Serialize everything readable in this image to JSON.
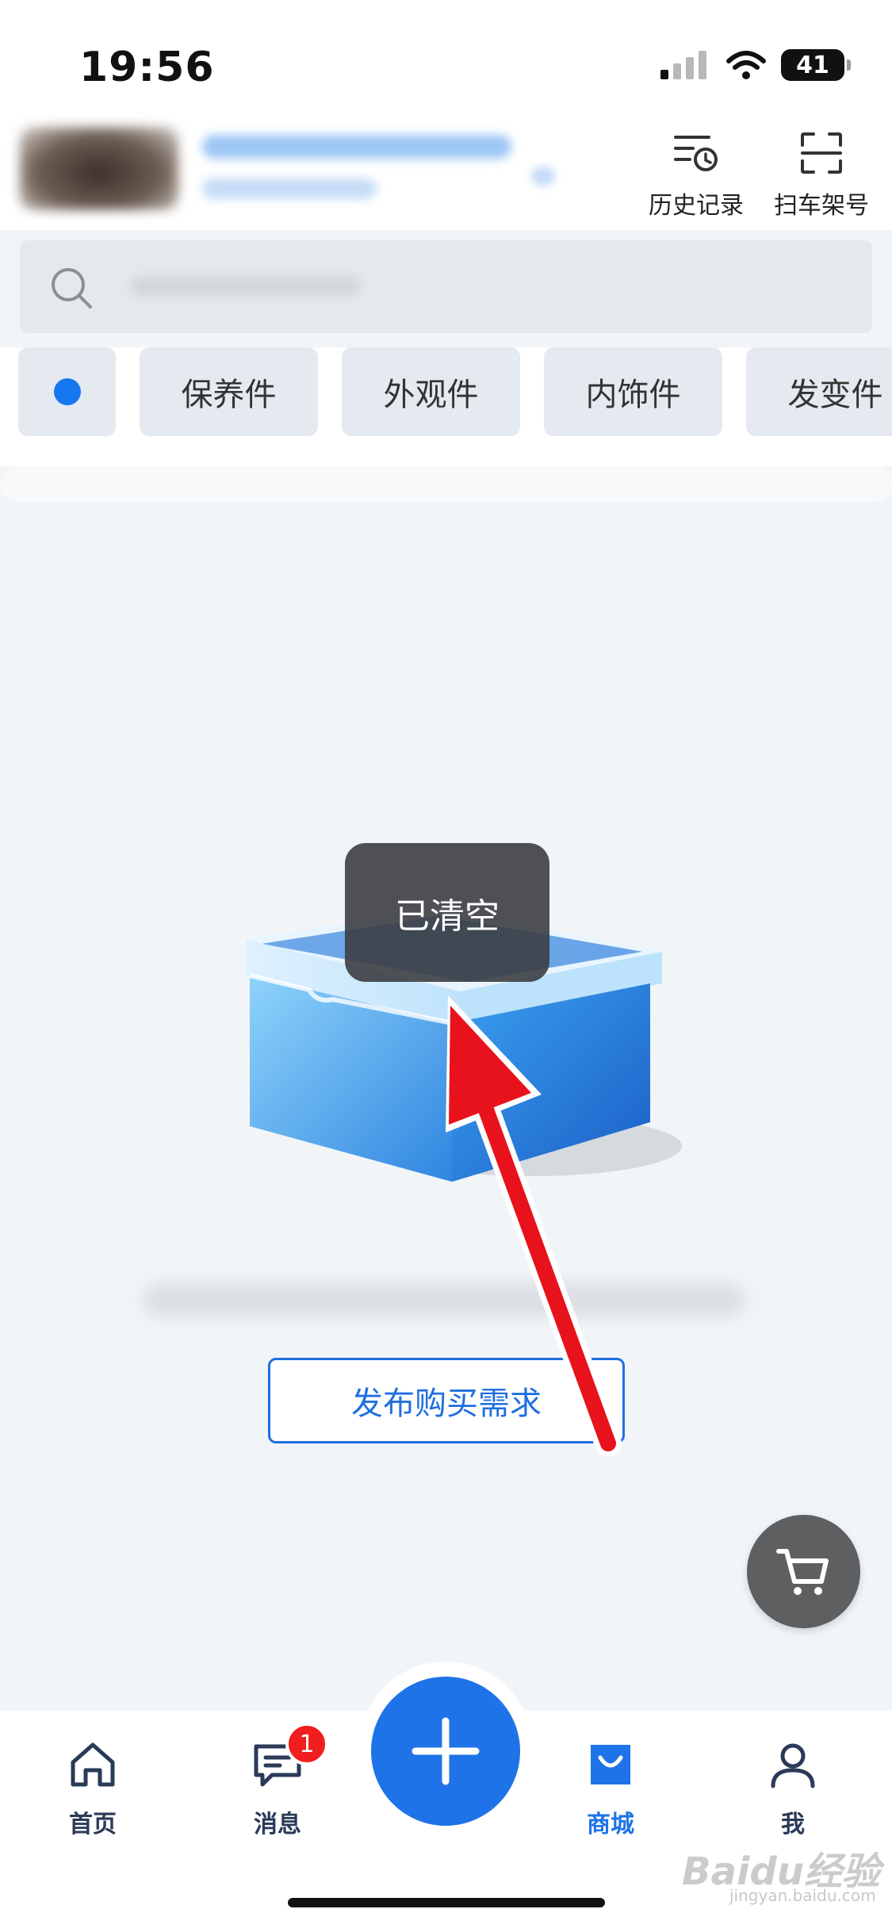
{
  "status_bar": {
    "time": "19:56",
    "battery": "41"
  },
  "header": {
    "history_label": "历史记录",
    "scan_label": "扫车架号"
  },
  "categories": [
    {
      "label": ""
    },
    {
      "label": "保养件"
    },
    {
      "label": "外观件"
    },
    {
      "label": "内饰件"
    },
    {
      "label": "发变件"
    }
  ],
  "toast": {
    "text": "已清空"
  },
  "empty_state": {
    "button_label": "发布购买需求"
  },
  "tabbar": {
    "items": [
      {
        "label": "首页",
        "icon": "home-icon"
      },
      {
        "label": "消息",
        "icon": "message-icon",
        "badge": "1"
      },
      {
        "label": "商城",
        "icon": "shopping-bag-icon",
        "active": true
      },
      {
        "label": "我",
        "icon": "person-icon"
      }
    ]
  },
  "watermark": {
    "brand": "Baidu经验",
    "url": "jingyan.baidu.com"
  },
  "colors": {
    "accent": "#1f73e8",
    "badge": "#f01e1e",
    "arrow": "#e8121c",
    "background": "#f1f5f8"
  }
}
